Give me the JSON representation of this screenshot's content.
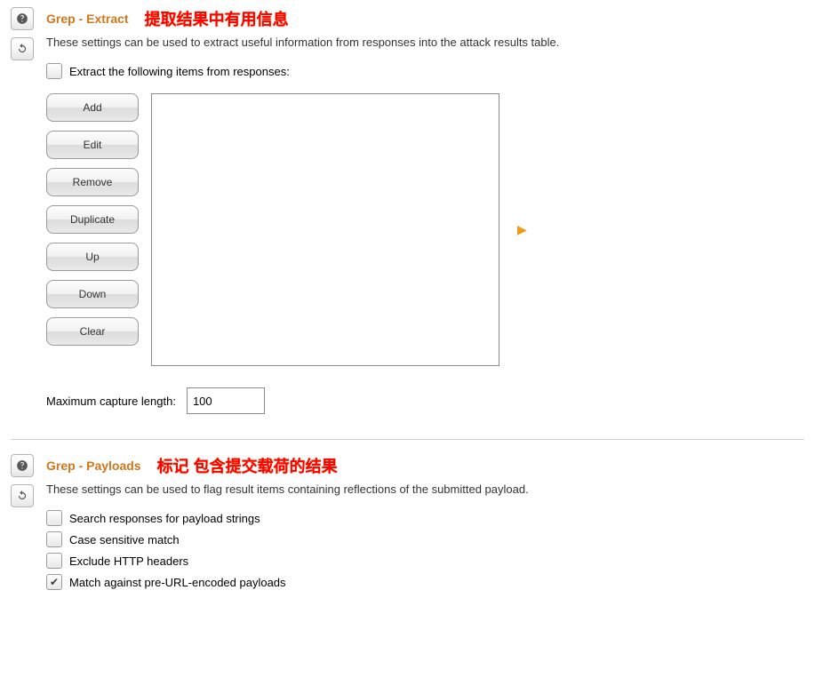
{
  "extract": {
    "title": "Grep - Extract",
    "annotation": "提取结果中有用信息",
    "desc": "These settings can be used to extract useful information from responses into the attack results table.",
    "extract_checkbox_label": "Extract the following items from responses:",
    "buttons": {
      "add": "Add",
      "edit": "Edit",
      "remove": "Remove",
      "duplicate": "Duplicate",
      "up": "Up",
      "down": "Down",
      "clear": "Clear"
    },
    "max_capture_label": "Maximum capture length:",
    "max_capture_value": "100"
  },
  "payloads": {
    "title": "Grep - Payloads",
    "annotation": "标记 包含提交载荷的结果",
    "desc": "These settings can be used to flag result items containing reflections of the submitted payload.",
    "checks": {
      "search": "Search responses for payload strings",
      "case": "Case sensitive match",
      "exclude": "Exclude HTTP headers",
      "match": "Match against pre-URL-encoded payloads"
    }
  }
}
